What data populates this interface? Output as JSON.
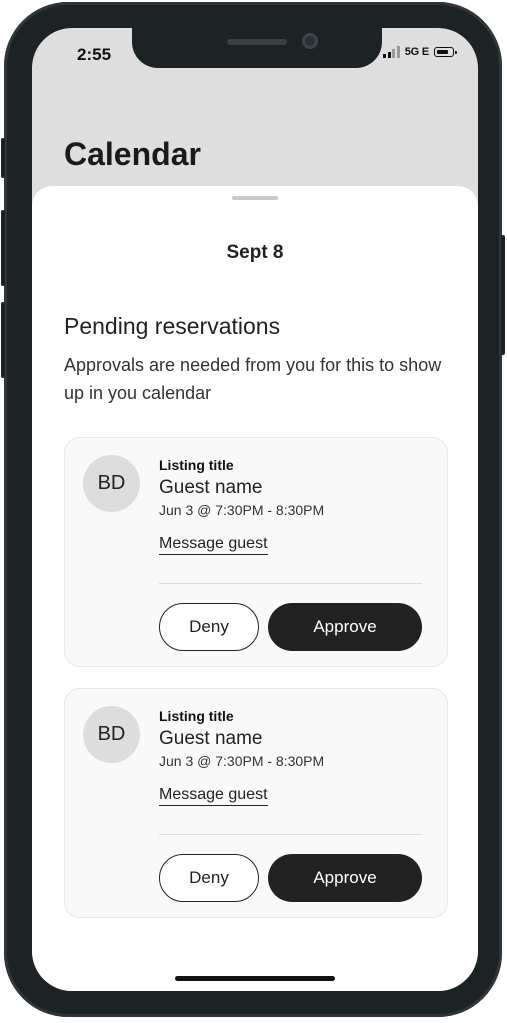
{
  "status_bar": {
    "time": "2:55",
    "network": "5G E"
  },
  "header": {
    "title": "Calendar"
  },
  "sheet": {
    "date": "Sept 8",
    "section_title": "Pending reservations",
    "section_description": "Approvals are needed from you for this to show up in you calendar"
  },
  "reservations": [
    {
      "initials": "BD",
      "listing_title": "Listing title",
      "guest_name": "Guest name",
      "time": "Jun 3 @ 7:30PM - 8:30PM",
      "message_label": "Message guest",
      "deny_label": "Deny",
      "approve_label": "Approve"
    },
    {
      "initials": "BD",
      "listing_title": "Listing title",
      "guest_name": "Guest name",
      "time": "Jun 3 @ 7:30PM - 8:30PM",
      "message_label": "Message guest",
      "deny_label": "Deny",
      "approve_label": "Approve"
    }
  ],
  "colors": {
    "primary_button": "#222222",
    "background_header": "#dedede",
    "card_background": "#f9f9f9"
  },
  "icons": [
    "signal-icon",
    "battery-icon"
  ]
}
